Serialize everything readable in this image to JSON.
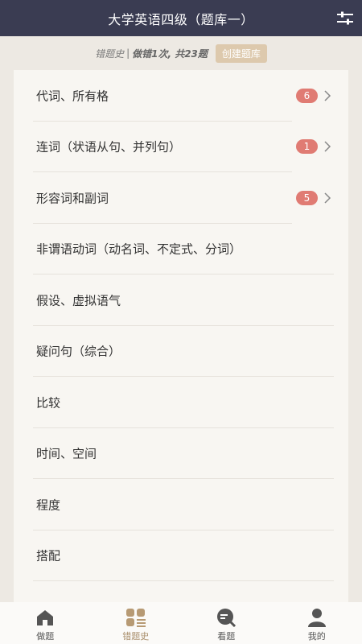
{
  "header": {
    "title": "大学英语四级（题库一）",
    "settings_icon": "sliders-icon"
  },
  "subbar": {
    "label": "错题史",
    "separator": "|",
    "stats": "做错1次, 共23题",
    "create_button": "创建题库"
  },
  "list": {
    "items": [
      {
        "label": "代词、所有格",
        "badge": "6"
      },
      {
        "label": "连词（状语从句、并列句）",
        "badge": "1"
      },
      {
        "label": "形容词和副词",
        "badge": "5"
      },
      {
        "label": "非谓语动词（动名词、不定式、分词）"
      },
      {
        "label": "假设、虚拟语气"
      },
      {
        "label": "疑问句（综合）"
      },
      {
        "label": "比较"
      },
      {
        "label": "时间、空间"
      },
      {
        "label": "程度"
      },
      {
        "label": "搭配"
      }
    ]
  },
  "tabs": [
    {
      "label": "做题",
      "icon": "home-icon"
    },
    {
      "label": "错题史",
      "icon": "grid-list-icon",
      "active": true
    },
    {
      "label": "看题",
      "icon": "search-chat-icon"
    },
    {
      "label": "我的",
      "icon": "person-icon"
    }
  ],
  "colors": {
    "header_bg": "#3a3c52",
    "badge": "#e07b73",
    "accent": "#a88d6a",
    "create_button_bg": "#ddc9ad"
  }
}
